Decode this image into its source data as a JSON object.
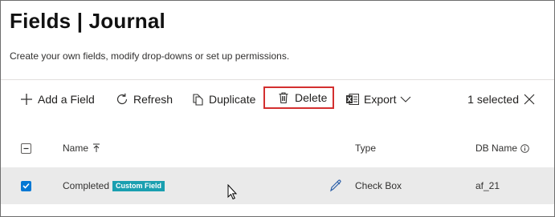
{
  "page": {
    "title": "Fields | Journal",
    "subtitle": "Create your own fields, modify drop-downs or set up permissions."
  },
  "toolbar": {
    "add_label": "Add a Field",
    "refresh_label": "Refresh",
    "duplicate_label": "Duplicate",
    "delete_label": "Delete",
    "export_label": "Export",
    "selected_label": "1 selected"
  },
  "table": {
    "columns": {
      "name": "Name",
      "type": "Type",
      "db_name": "DB Name"
    },
    "rows": [
      {
        "name": "Completed",
        "badge": "Custom Field",
        "type": "Check Box",
        "db_name": "af_21",
        "selected": true
      }
    ]
  },
  "colors": {
    "accent": "#0078d4",
    "highlight_border": "#d32f2f",
    "badge": "#1a9fb0",
    "selected_row": "#eaeaea"
  },
  "icons": [
    "plus-icon",
    "refresh-icon",
    "duplicate-icon",
    "delete-icon",
    "excel-icon",
    "chevron-down-icon",
    "close-icon",
    "sort-up-icon",
    "info-icon",
    "edit-pencil-icon",
    "checkmark-icon",
    "mouse-cursor-icon"
  ]
}
